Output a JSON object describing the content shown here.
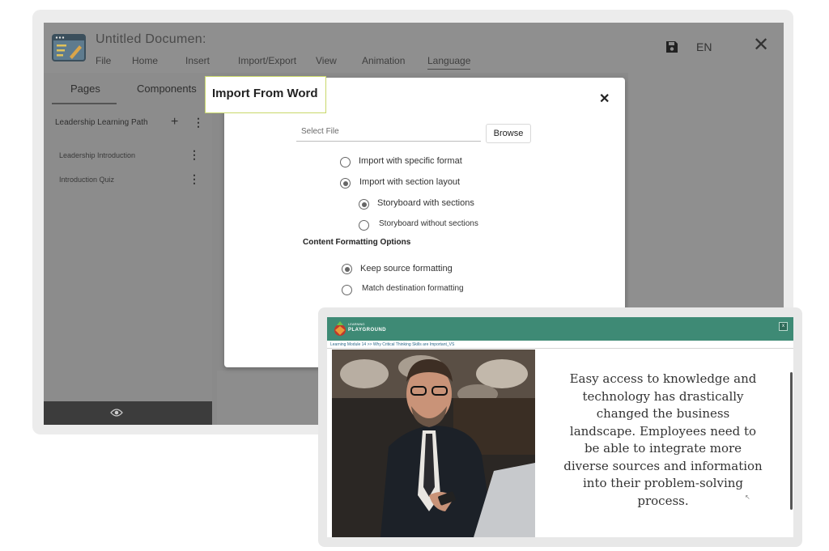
{
  "app": {
    "title": "Untitled Documen:",
    "menu": [
      "File",
      "Home",
      "Insert",
      "Import/Export",
      "View",
      "Animation",
      "Language"
    ],
    "language": "EN"
  },
  "sidebar": {
    "tabs": [
      "Pages",
      "Components"
    ],
    "path_title": "Leadership Learning Path",
    "pages": [
      "Leadership Introduction",
      "Introduction Quiz"
    ]
  },
  "dialog": {
    "title": "Import From Word",
    "file_placeholder": "Select File",
    "browse_label": "Browse",
    "options": {
      "specific_format": "Import with specific format",
      "section_layout": "Import with section layout",
      "with_sections": "Storyboard with sections",
      "without_sections": "Storyboard without sections"
    },
    "formatting_heading": "Content Formatting Options",
    "formatting": {
      "keep_source": "Keep source formatting",
      "match_destination": "Match destination formatting"
    },
    "selected_import": "Import with section layout",
    "selected_storyboard": "Storyboard with sections",
    "selected_formatting": "Keep source formatting"
  },
  "preview": {
    "logo_small": "LEARNING",
    "logo_text": "PLAYGROUND",
    "breadcrumb": "Learning Module 14 >> Why Critical Thinking Skills are Important_VS",
    "close_label": "x",
    "body_text": "Easy access to knowledge and technology has drastically changed the business landscape. Employees need to be able to integrate more diverse sources and information into their problem-solving process."
  },
  "colors": {
    "preview_header": "#3e8a75",
    "overlay_gray": "#8a8a8a",
    "dialog_title_border": "#c9d86a"
  }
}
